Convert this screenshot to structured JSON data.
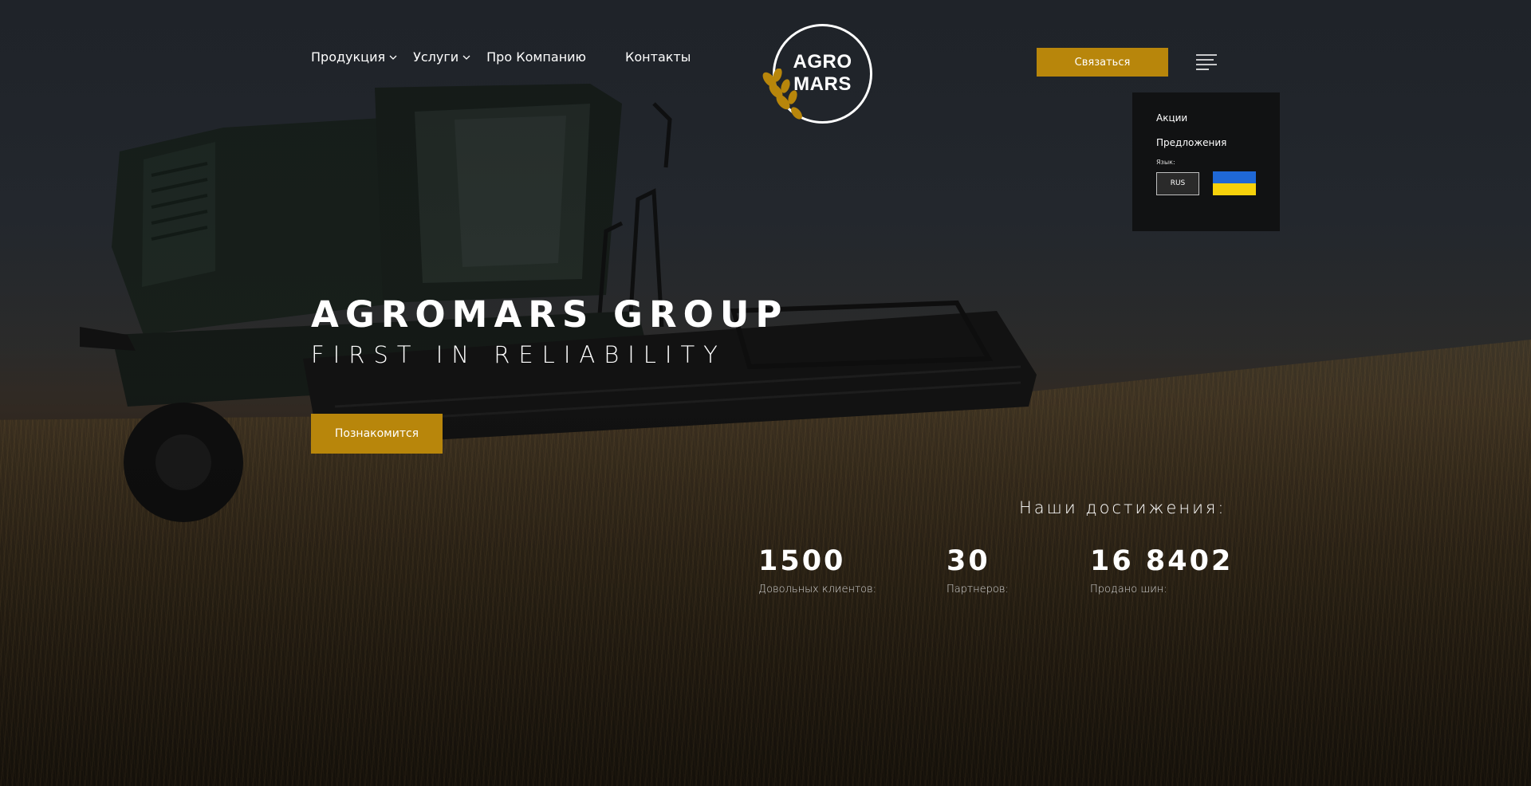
{
  "nav": {
    "products": "Продукция",
    "services": "Услуги",
    "about": "Про Компанию",
    "contacts": "Контакты"
  },
  "logo": {
    "line1": "AGRO",
    "line2": "MARS"
  },
  "header": {
    "contact_button": "Связаться"
  },
  "dropdown": {
    "promotions": "Акции",
    "offers": "Предложения",
    "language_label": "Язык:",
    "language_current": "RUS",
    "alt_language_flag": "ukraine-flag-icon"
  },
  "hero": {
    "title": "AGROMARS GROUP",
    "subtitle": "FIRST IN RELIABILITY",
    "cta": "Познакомится"
  },
  "achievements": {
    "title": "Наши достижения:",
    "items": [
      {
        "value": "1500",
        "label": "Довольных клиентов:"
      },
      {
        "value": "30",
        "label": "Партнеров:"
      },
      {
        "value": "16 8402",
        "label": "Продано шин:"
      }
    ]
  },
  "colors": {
    "accent": "#b8860b",
    "dropdown_bg": "#111213",
    "text": "#ffffff"
  }
}
